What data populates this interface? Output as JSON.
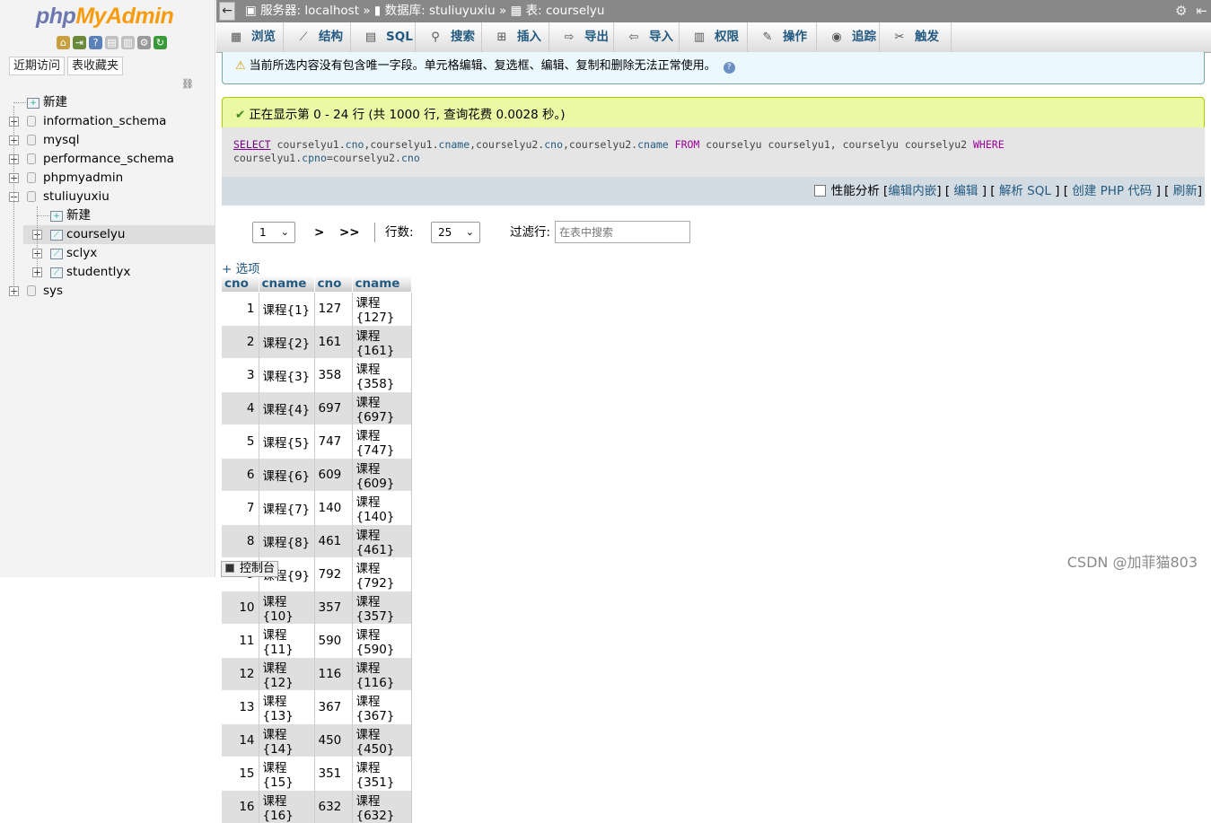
{
  "nav": {
    "logo_php": "php",
    "logo_myadmin": "MyAdmin",
    "tabs": [
      "近期访问",
      "表收藏夹"
    ],
    "tree": [
      {
        "label": "新建",
        "level": 0,
        "type": "new"
      },
      {
        "label": "information_schema",
        "level": 0,
        "type": "db"
      },
      {
        "label": "mysql",
        "level": 0,
        "type": "db"
      },
      {
        "label": "performance_schema",
        "level": 0,
        "type": "db"
      },
      {
        "label": "phpmyadmin",
        "level": 0,
        "type": "db"
      },
      {
        "label": "stuliuyuxiu",
        "level": 0,
        "type": "db",
        "expanded": true
      },
      {
        "label": "新建",
        "level": 1,
        "type": "new"
      },
      {
        "label": "courselyu",
        "level": 1,
        "type": "table",
        "selected": true
      },
      {
        "label": "sclyx",
        "level": 1,
        "type": "table"
      },
      {
        "label": "studentlyx",
        "level": 1,
        "type": "table"
      },
      {
        "label": "sys",
        "level": 0,
        "type": "db"
      }
    ]
  },
  "breadcrumb": {
    "server": "服务器: localhost",
    "database": "数据库: stuliuyuxiu",
    "table": "表: courselyu",
    "sep": "»"
  },
  "menu": [
    {
      "label": "浏览",
      "icon": "browse-icon"
    },
    {
      "label": "结构",
      "icon": "structure-icon"
    },
    {
      "label": "SQL",
      "icon": "sql-icon"
    },
    {
      "label": "搜索",
      "icon": "search-icon"
    },
    {
      "label": "插入",
      "icon": "insert-icon"
    },
    {
      "label": "导出",
      "icon": "export-icon"
    },
    {
      "label": "导入",
      "icon": "import-icon"
    },
    {
      "label": "权限",
      "icon": "privileges-icon"
    },
    {
      "label": "操作",
      "icon": "operations-icon"
    },
    {
      "label": "追踪",
      "icon": "tracking-icon"
    },
    {
      "label": "触发器",
      "icon": "triggers-icon"
    }
  ],
  "notice": "当前所选内容没有包含唯一字段。单元格编辑、复选框、编辑、复制和删除无法正常使用。",
  "success": "正在显示第 0 - 24 行 (共 1000 行, 查询花费 0.0028 秒。)",
  "sql": {
    "line1": [
      {
        "t": "SELECT",
        "c": "k1"
      },
      {
        "t": " courselyu1.",
        "c": ""
      },
      {
        "t": "cno",
        "c": "col"
      },
      {
        "t": ",courselyu1.",
        "c": ""
      },
      {
        "t": "cname",
        "c": "col"
      },
      {
        "t": ",courselyu2.",
        "c": ""
      },
      {
        "t": "cno",
        "c": "col"
      },
      {
        "t": ",courselyu2.",
        "c": ""
      },
      {
        "t": "cname",
        "c": "col"
      },
      {
        "t": " FROM",
        "c": "kw"
      },
      {
        "t": " courselyu courselyu1, courselyu courselyu2 ",
        "c": ""
      },
      {
        "t": "WHERE",
        "c": "kw"
      }
    ],
    "line2": [
      {
        "t": "courselyu1.",
        "c": ""
      },
      {
        "t": "cpno",
        "c": "col"
      },
      {
        "t": "=courselyu2.",
        "c": ""
      },
      {
        "t": "cno",
        "c": "col"
      }
    ]
  },
  "sql_actions": {
    "profiling": "性能分析",
    "links": [
      "编辑内嵌",
      "编辑",
      "解析 SQL",
      "创建 PHP 代码",
      "刷新"
    ]
  },
  "pager": {
    "page": "1",
    "next": ">",
    "last": ">>",
    "rows_label": "行数:",
    "rows_value": "25",
    "filter_label": "过滤行:",
    "filter_placeholder": "在表中搜索"
  },
  "options_link": "+ 选项",
  "table": {
    "headers": [
      "cno",
      "cname",
      "cno",
      "cname"
    ],
    "rows": [
      [
        "1",
        "课程{1}",
        "127",
        "课程{127}"
      ],
      [
        "2",
        "课程{2}",
        "161",
        "课程{161}"
      ],
      [
        "3",
        "课程{3}",
        "358",
        "课程{358}"
      ],
      [
        "4",
        "课程{4}",
        "697",
        "课程{697}"
      ],
      [
        "5",
        "课程{5}",
        "747",
        "课程{747}"
      ],
      [
        "6",
        "课程{6}",
        "609",
        "课程{609}"
      ],
      [
        "7",
        "课程{7}",
        "140",
        "课程{140}"
      ],
      [
        "8",
        "课程{8}",
        "461",
        "课程{461}"
      ],
      [
        "9",
        "课程{9}",
        "792",
        "课程{792}"
      ],
      [
        "10",
        "课程{10}",
        "357",
        "课程{357}"
      ],
      [
        "11",
        "课程{11}",
        "590",
        "课程{590}"
      ],
      [
        "12",
        "课程{12}",
        "116",
        "课程{116}"
      ],
      [
        "13",
        "课程{13}",
        "367",
        "课程{367}"
      ],
      [
        "14",
        "课程{14}",
        "450",
        "课程{450}"
      ],
      [
        "15",
        "课程{15}",
        "351",
        "课程{351}"
      ],
      [
        "16",
        "课程{16}",
        "632",
        "课程{632}"
      ]
    ]
  },
  "console": "控制台",
  "watermark": "CSDN @加菲猫803"
}
